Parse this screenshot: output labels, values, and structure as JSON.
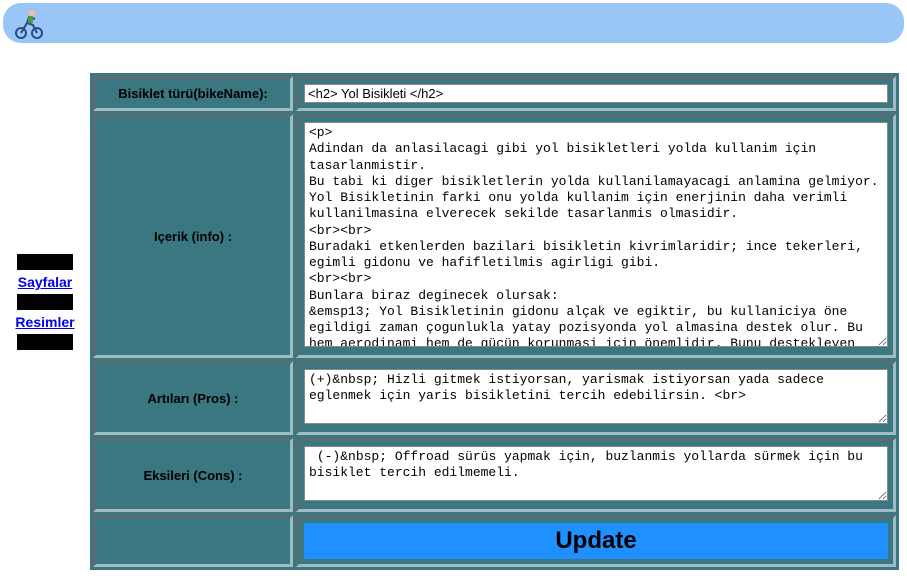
{
  "sidebar": {
    "link_sayfalar": "Sayfalar",
    "link_resimler": "Resimler"
  },
  "form": {
    "labels": {
      "bike_name": "Bisiklet türü(bikeName):",
      "info": "Içerik (info)  :",
      "pros": "Artıları (Pros) :",
      "cons": "Eksileri (Cons) :"
    },
    "values": {
      "bike_name": "<h2> Yol Bisikleti </h2>",
      "info": "<p>\nAdindan da anlasilacagi gibi yol bisikletleri yolda kullanim için tasarlanmistir.\nBu tabi ki diger bisikletlerin yolda kullanilamayacagi anlamina gelmiyor. Yol Bisikletinin farki onu yolda kullanim için enerjinin daha verimli kullanilmasina elverecek sekilde tasarlanmis olmasidir.\n<br><br>\nBuradaki etkenlerden bazilari bisikletin kivrimlaridir; ince tekerleri, egimli gidonu ve hafifletilmis agirligi gibi.\n<br><br>\nBunlara biraz deginecek olursak:\n&emsp13; Yol Bisikletinin gidonu alçak ve egiktir, bu kullaniciya öne egildigi zaman çogunlukla yatay pozisyonda yol almasina destek olur. Bu hem aerodinami hem de gücün korunmasi için önemlidir. Bunu destekleyen faktörlerden bir digeri kadçonun ince ve yine aerodinamik olarak tasarlanmis olmasidir. Kalkis",
      "pros": "(+)&nbsp; Hizli gitmek istiyorsan, yarismak istiyorsan yada sadece eglenmek için yaris bisikletini tercih edebilirsin. <br>",
      "cons": " (-)&nbsp; Offroad sürüs yapmak için, buzlanmis yollarda sürmek için bu bisiklet tercih edilmemeli."
    },
    "update_button": "Update"
  }
}
